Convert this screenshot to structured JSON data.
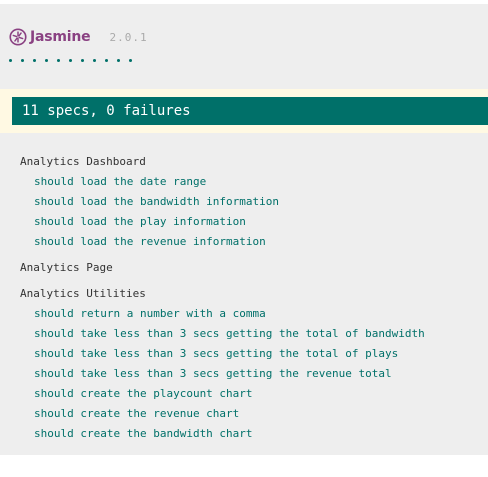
{
  "app": {
    "name": "Jasmine",
    "version": "2.0.1"
  },
  "colors": {
    "brand": "#8a4182",
    "pass": "#007069",
    "alert_bg": "#fff9e3"
  },
  "progress": {
    "passed_dots": 11
  },
  "summary": {
    "text": "11 specs, 0 failures"
  },
  "suites": [
    {
      "name": "Analytics Dashboard",
      "specs": [
        "should load the date range",
        "should load the bandwidth information",
        "should load the play information",
        "should load the revenue information"
      ]
    },
    {
      "name": "Analytics Page",
      "specs": []
    },
    {
      "name": "Analytics Utilities",
      "specs": [
        "should return a number with a comma",
        "should take less than 3 secs getting the total of bandwidth",
        "should take less than 3 secs getting the total of plays",
        "should take less than 3 secs getting the revenue total",
        "should create the playcount chart",
        "should create the revenue chart",
        "should create the bandwidth chart"
      ]
    }
  ]
}
